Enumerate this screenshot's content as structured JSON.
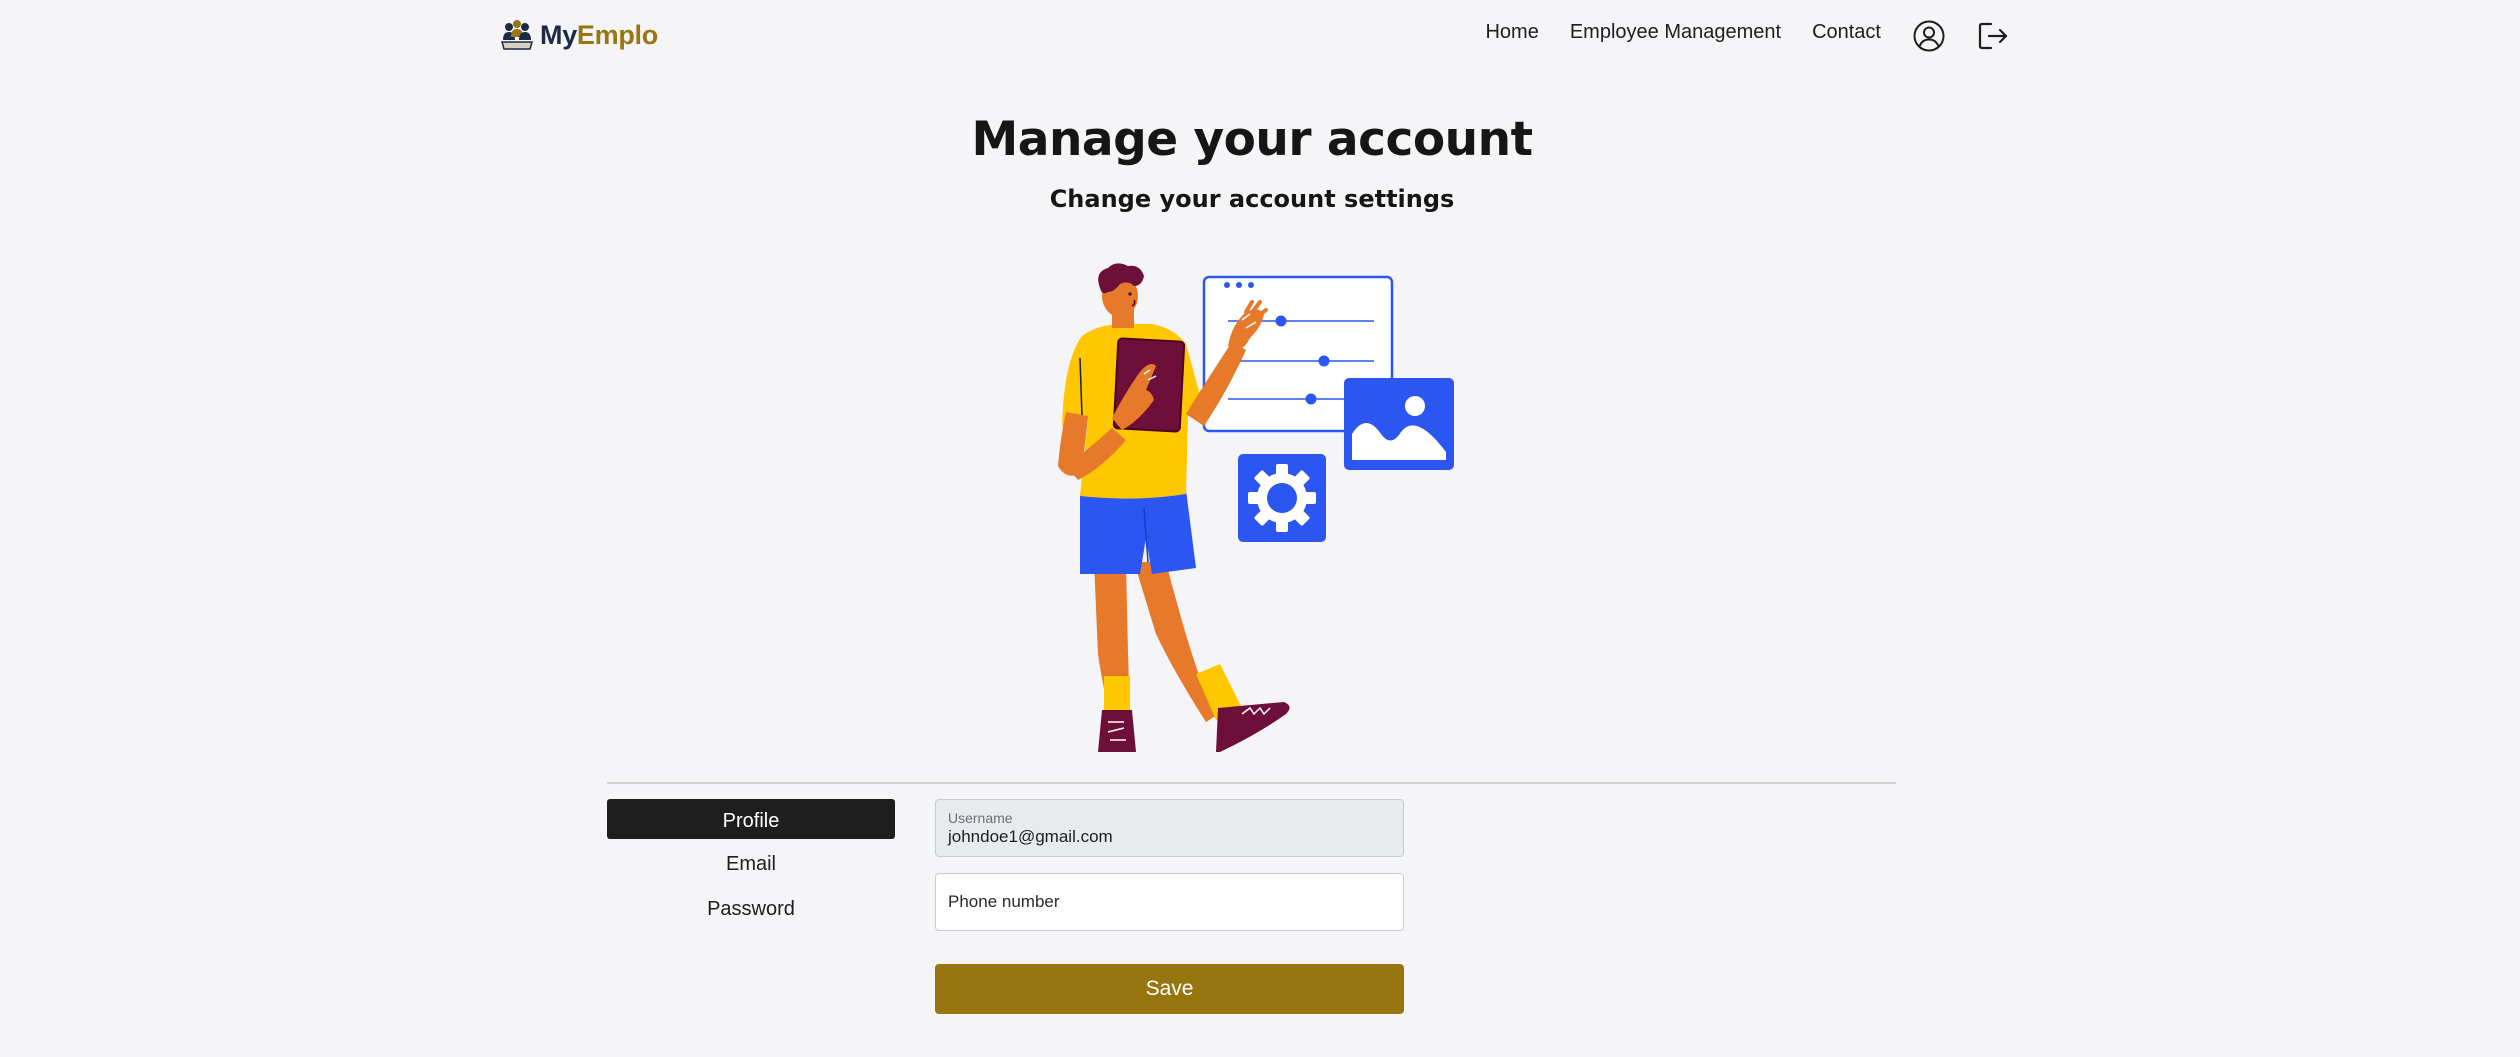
{
  "brand": {
    "part1": "My",
    "part2": "Emplo",
    "color_dark": "#1c2a44",
    "color_gold": "#987613"
  },
  "nav": {
    "links": [
      "Home",
      "Employee Management",
      "Contact"
    ],
    "icons": [
      "user-circle-icon",
      "logout-icon"
    ]
  },
  "page": {
    "title": "Manage your account",
    "subtitle": "Change your account settings"
  },
  "illustration": {
    "icon": "account-settings-illustration"
  },
  "menu": {
    "items": [
      "Profile",
      "Email",
      "Password"
    ],
    "active": "Profile"
  },
  "form": {
    "username_label": "Username",
    "username_value": "johndoe1@gmail.com",
    "phone_placeholder": "Phone number",
    "save_label": "Save"
  },
  "colors": {
    "accent": "#977610",
    "dark": "#1e1e1e",
    "background": "#f5f5f7",
    "illustration_blue": "#2c56f2",
    "illustration_yellow": "#ffc700",
    "illustration_orange": "#e6792a",
    "illustration_maroon": "#6e0f3a"
  }
}
